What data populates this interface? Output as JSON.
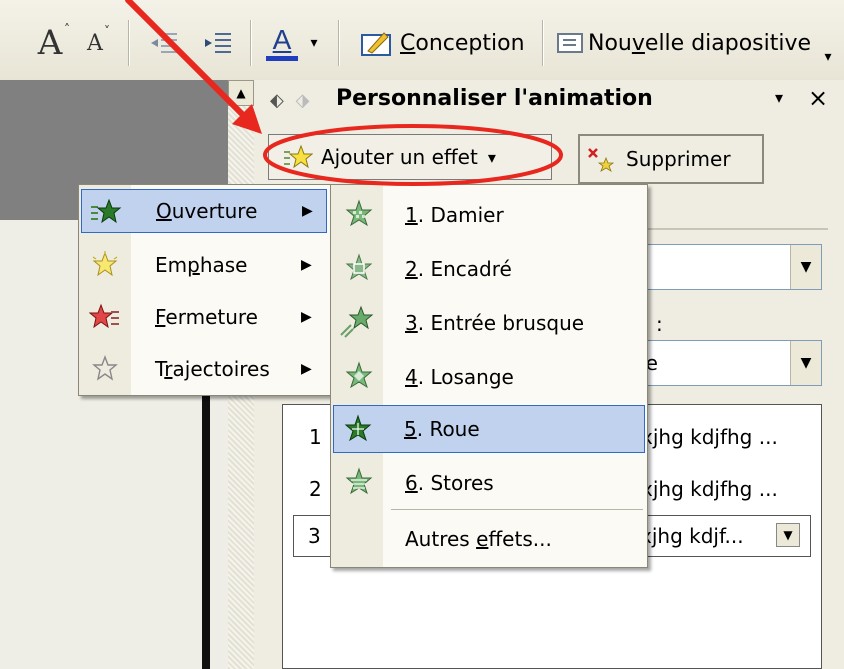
{
  "toolbar": {
    "font_grow": "A",
    "font_shrink": "A",
    "font_color_letter": "A",
    "design_label_prefix": "",
    "design_label_ul": "C",
    "design_label_rest": "onception",
    "new_slide_label_pre": "Nou",
    "new_slide_label_ul": "v",
    "new_slide_label_rest": "elle diapositive"
  },
  "task_pane": {
    "title": "Personnaliser l'animation",
    "close": "×",
    "menu_arrow": "▾",
    "add_effect": "Ajouter un effet",
    "add_effect_arrow": "▾",
    "delete": "Supprimer",
    "combo1_value": "",
    "colon_label": ":",
    "combo2_value": "ne",
    "list": [
      {
        "num": "1",
        "text": "xjhg kdjfhg ..."
      },
      {
        "num": "2",
        "text": "xjhg kdjfhg ..."
      },
      {
        "num": "3",
        "text": "xjhg kdjf..."
      }
    ]
  },
  "menu1": {
    "items": [
      {
        "label_ul": "O",
        "label_rest": "uverture",
        "highlighted": true,
        "icon": "star-green-icon"
      },
      {
        "label_pre": "Em",
        "label_ul": "p",
        "label_rest": "hase",
        "icon": "star-yellow-icon"
      },
      {
        "label_ul": "F",
        "label_rest": "ermeture",
        "icon": "star-red-icon"
      },
      {
        "label_pre": "T",
        "label_ul": "r",
        "label_rest": "ajectoires",
        "icon": "star-outline-icon"
      }
    ]
  },
  "menu2": {
    "items": [
      {
        "num": "1",
        "label": ". Damier"
      },
      {
        "num": "2",
        "label": ". Encadré"
      },
      {
        "num": "3",
        "label": ". Entrée brusque"
      },
      {
        "num": "4",
        "label": ". Losange"
      },
      {
        "num": "5",
        "label": ". Roue",
        "highlighted": true
      },
      {
        "num": "6",
        "label": ". Stores"
      }
    ],
    "more_pre": "Autres ",
    "more_ul": "e",
    "more_rest": "ffets..."
  },
  "colors": {
    "annotation_red": "#e8281e",
    "highlight": "#c1d2ee",
    "highlight_border": "#316ac5"
  }
}
